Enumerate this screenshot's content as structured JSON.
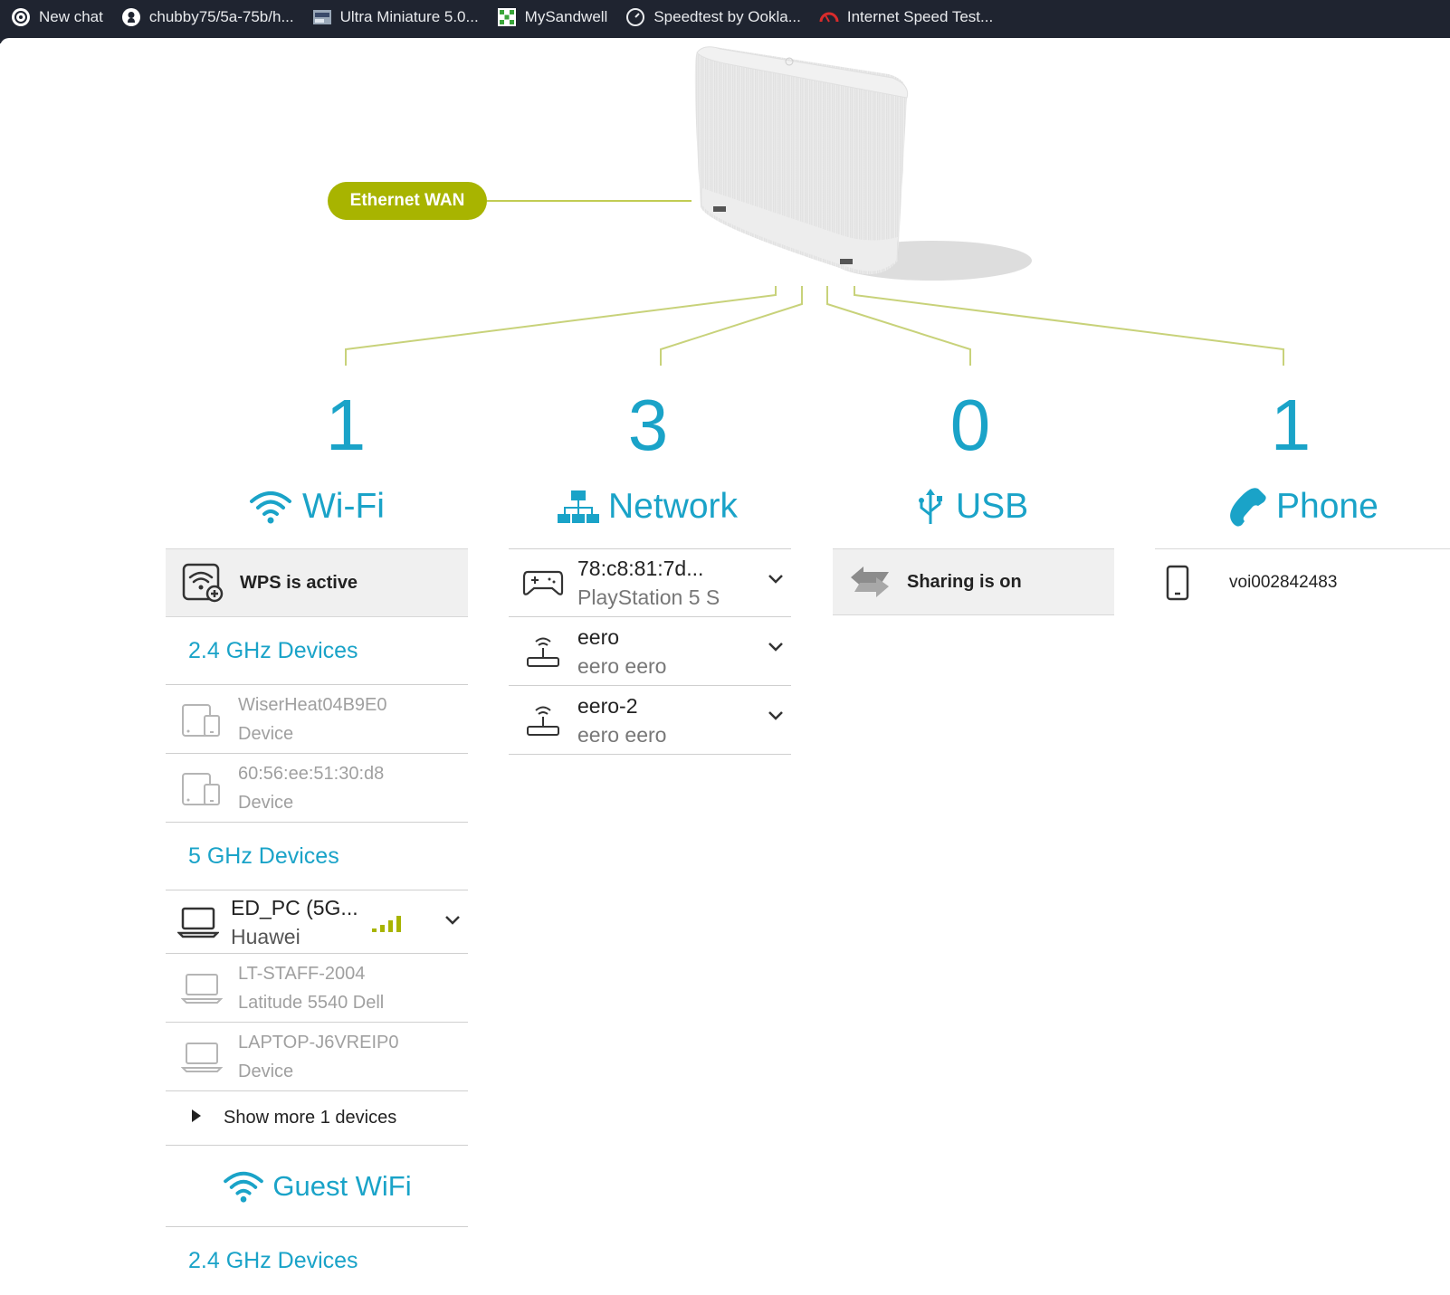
{
  "bookmarks": [
    {
      "label": "New chat",
      "icon": "openai-icon"
    },
    {
      "label": "chubby75/5a-75b/h...",
      "icon": "github-icon"
    },
    {
      "label": "Ultra Miniature 5.0...",
      "icon": "site-thumbnail-icon"
    },
    {
      "label": "MySandwell",
      "icon": "mysandwell-icon"
    },
    {
      "label": "Speedtest by Ookla...",
      "icon": "speedtest-icon"
    },
    {
      "label": "Internet Speed Test...",
      "icon": "speed-gauge-icon"
    }
  ],
  "router": {
    "wan_label": "Ethernet WAN"
  },
  "colors": {
    "accent": "#1aa3c8",
    "wan": "#a8b400",
    "signal": "#a8b400"
  },
  "categories": [
    {
      "count": "1",
      "label": "Wi-Fi",
      "icon": "wifi-icon"
    },
    {
      "count": "3",
      "label": "Network",
      "icon": "network-icon"
    },
    {
      "count": "0",
      "label": "USB",
      "icon": "usb-icon"
    },
    {
      "count": "1",
      "label": "Phone",
      "icon": "phone-icon"
    }
  ],
  "wifi": {
    "wps_status": "WPS is active",
    "band_24_title": "2.4 GHz Devices",
    "band_24_devices": [
      {
        "name": "WiserHeat04B9E0",
        "type": "Device"
      },
      {
        "name": "60:56:ee:51:30:d8",
        "type": "Device"
      }
    ],
    "band_5_title": "5 GHz Devices",
    "band_5_devices": [
      {
        "name": "ED_PC (5G...",
        "type": "Huawei",
        "signal_bars": 4
      },
      {
        "name": "LT-STAFF-2004",
        "type": "Latitude 5540 Dell"
      },
      {
        "name": "LAPTOP-J6VREIP0",
        "type": "Device"
      }
    ],
    "show_more": "Show more 1 devices",
    "guest_title": "Guest WiFi",
    "guest_band_24_title": "2.4 GHz Devices"
  },
  "network": {
    "devices": [
      {
        "name": "78:c8:81:7d...",
        "type": "PlayStation 5 S"
      },
      {
        "name": "eero",
        "type": "eero eero"
      },
      {
        "name": "eero-2",
        "type": "eero eero"
      }
    ]
  },
  "usb": {
    "sharing_status": "Sharing is on"
  },
  "phone": {
    "number": "voi002842483"
  }
}
